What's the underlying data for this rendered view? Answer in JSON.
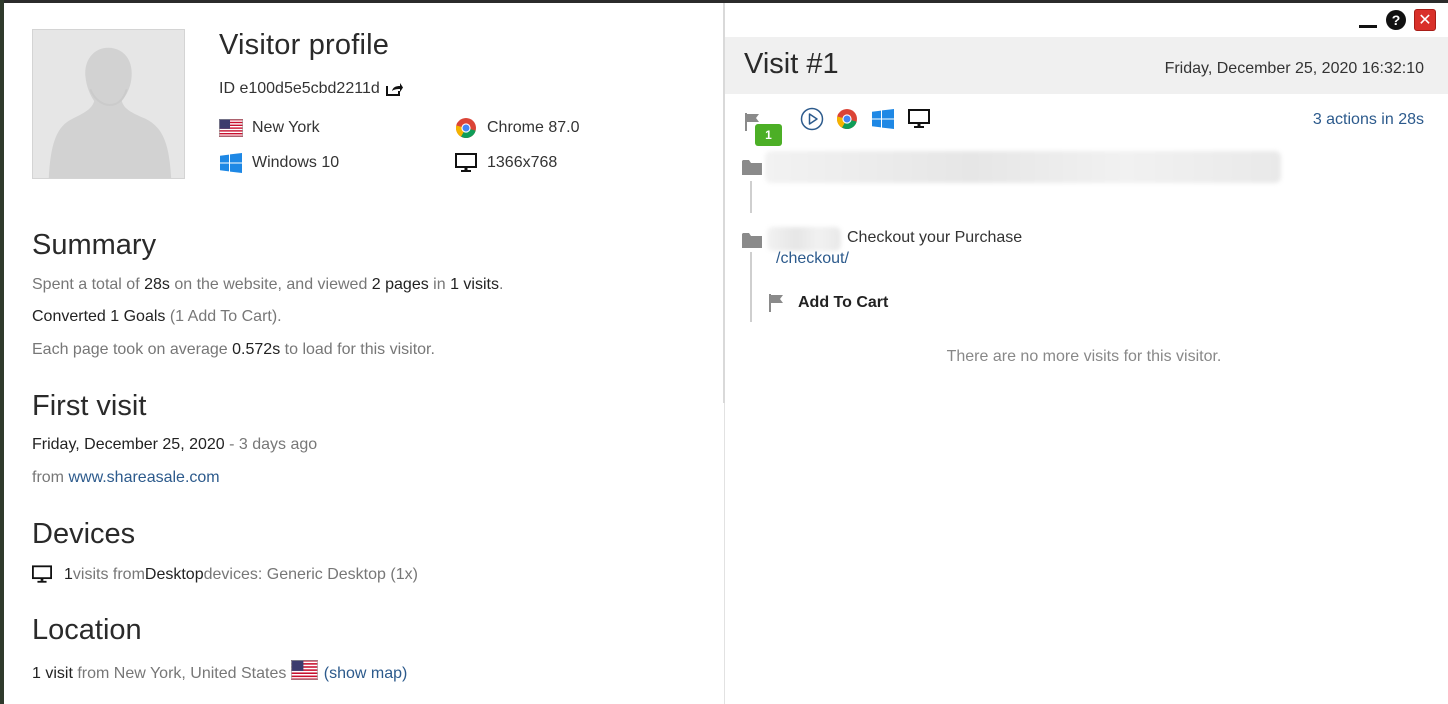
{
  "profile": {
    "title": "Visitor profile",
    "id_text": "ID e100d5e5cbd2211d",
    "city": "New York",
    "browser": "Chrome 87.0",
    "os": "Windows 10",
    "resolution": "1366x768"
  },
  "summary": {
    "heading": "Summary",
    "line1": {
      "p1": "Spent a total of ",
      "time": "28s",
      "p2": " on the website, and viewed ",
      "pages": "2 pages",
      "p3": " in ",
      "visits": "1 visits",
      "p4": "."
    },
    "line2": {
      "goals": "Converted 1 Goals",
      "detail": " (1 Add To Cart)."
    },
    "line3": {
      "p1": "Each page took on average ",
      "avg": "0.572s",
      "p2": " to load for this visitor."
    }
  },
  "first_visit": {
    "heading": "First visit",
    "date": "Friday, December 25, 2020",
    "ago": " - 3 days ago",
    "from_label": "from ",
    "referrer": "www.shareasale.com"
  },
  "devices": {
    "heading": "Devices",
    "count": "1",
    "p1": " visits from ",
    "type": "Desktop",
    "p2": " devices: Generic Desktop (1x)"
  },
  "location": {
    "heading": "Location",
    "visits": "1 visit",
    "p1": " from New York, United States ",
    "show_map": "(show map)"
  },
  "visit": {
    "title": "Visit #1",
    "datetime": "Friday, December 25, 2020 16:32:10",
    "goal_count": "1",
    "actions_summary": "3 actions in 28s",
    "page2_title": "Checkout your Purchase",
    "page2_url": "/checkout/",
    "goal_name": "Add To Cart",
    "no_more": "There are no more visits for this visitor."
  },
  "window": {
    "help": "?",
    "close": "✕"
  },
  "icons": [
    "share-icon",
    "us-flag-icon",
    "chrome-icon",
    "windows-icon",
    "monitor-icon",
    "flag-icon",
    "play-icon",
    "folder-icon",
    "minimize-icon",
    "help-icon",
    "close-icon"
  ],
  "colors": {
    "link": "#2c5a8c",
    "goal_badge": "#4caf26",
    "close": "#d9302a",
    "header_bg": "#f0f0f0"
  }
}
